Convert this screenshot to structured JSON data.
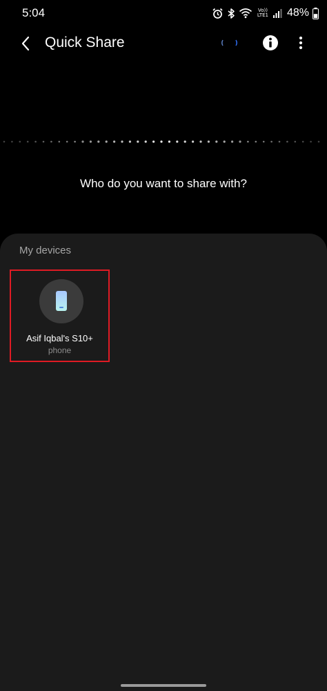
{
  "status_bar": {
    "time": "5:04",
    "battery_percent": "48%",
    "network_label": "Vo)) LTE1",
    "icons": [
      "alarm-icon",
      "bluetooth-icon",
      "wifi-icon",
      "signal-icon",
      "battery-icon"
    ]
  },
  "app_bar": {
    "title": "Quick Share",
    "icons": [
      "back-arrow-icon",
      "loading-indicator",
      "info-icon",
      "more-options-icon"
    ]
  },
  "prompt": "Who do you want to share with?",
  "devices_panel": {
    "section_label": "My devices",
    "devices": [
      {
        "name": "Asif Iqbal's S10+",
        "type": "phone",
        "icon": "phone-icon"
      }
    ]
  },
  "colors": {
    "background": "#000000",
    "panel": "#1b1b1b",
    "highlight_border": "#e01b24",
    "muted_text": "#a6a6a6"
  }
}
